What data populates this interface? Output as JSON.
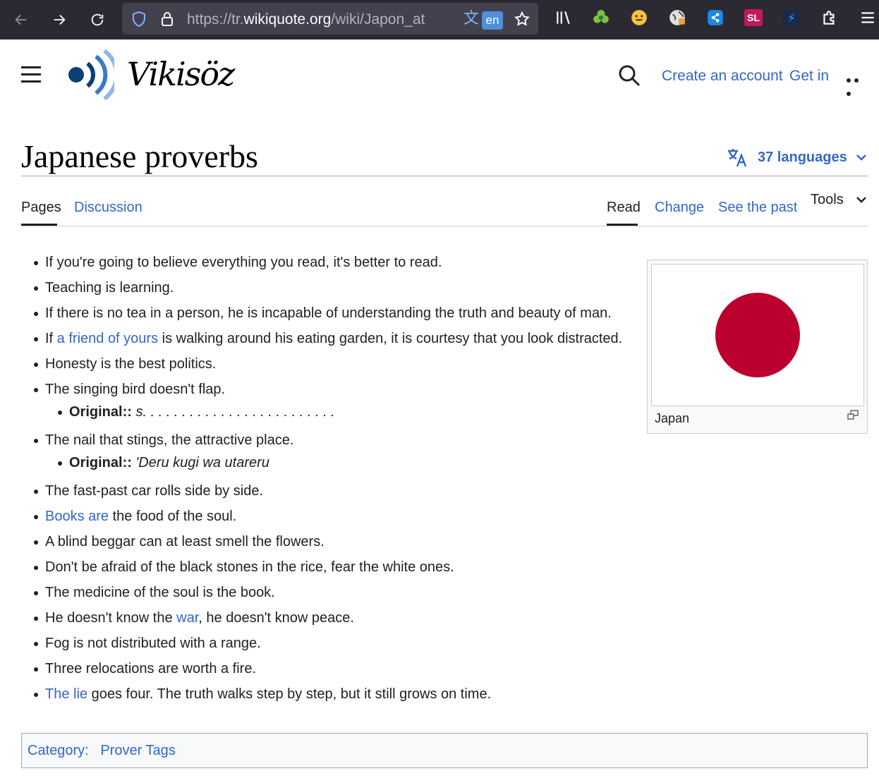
{
  "browser": {
    "url_prefix": "https://tr.",
    "url_domain": "wikiquote.org",
    "url_path": "/wiki/Japon_at",
    "translate_badge": "en",
    "extension_sl_label": "SL"
  },
  "header": {
    "wordmark": "Vikisöz",
    "create_account": "Create an account",
    "login": "Get in"
  },
  "page": {
    "title": "Japanese proverbs",
    "languages_label": "37 languages"
  },
  "tabs": {
    "pages": "Pages",
    "discussion": "Discussion",
    "read": "Read",
    "change": "Change",
    "history": "See the past",
    "tools": "Tools"
  },
  "quotes": [
    {
      "text": "If you're going to believe everything you read, it's better to read."
    },
    {
      "text": "Teaching is learning."
    },
    {
      "text": "If there is no tea in a person, he is incapable of understanding the truth and beauty of man."
    },
    {
      "pre": "If ",
      "link": "a friend of yours",
      "post": " is walking around his eating garden, it is courtesy that you look distracted."
    },
    {
      "text": "Honesty is the best politics."
    },
    {
      "text": "The singing bird doesn't flap.",
      "original_label": "Original::",
      "original": "s. . . . . . . . . . . . . . . . . . . . . . . . ."
    },
    {
      "text": "The nail that stings, the attractive place.",
      "original_label": "Original::",
      "original": "'Deru kugi wa utareru"
    },
    {
      "text": "The fast-past car rolls side by side."
    },
    {
      "link": "Books are",
      "post": " the food of the soul."
    },
    {
      "text": "A blind beggar can at least smell the flowers."
    },
    {
      "text": "Don't be afraid of the black stones in the rice, fear the white ones."
    },
    {
      "text": "The medicine of the soul is the book."
    },
    {
      "pre": "He doesn't know the ",
      "link": "war",
      "post": ", he doesn't know peace."
    },
    {
      "text": "Fog is not distributed with a range."
    },
    {
      "text": "Three relocations are worth a fire."
    },
    {
      "link": "The lie",
      "post": " goes four. The truth walks step by step, but it still grows on time."
    }
  ],
  "infobox": {
    "caption": "Japan",
    "flag_color": "#bc002d"
  },
  "category": {
    "label": "Category:",
    "link": "Prover Tags"
  },
  "colors": {
    "link": "#3366cc",
    "chrome_bg": "#2b2a33",
    "urlbar_bg": "#42414d"
  }
}
